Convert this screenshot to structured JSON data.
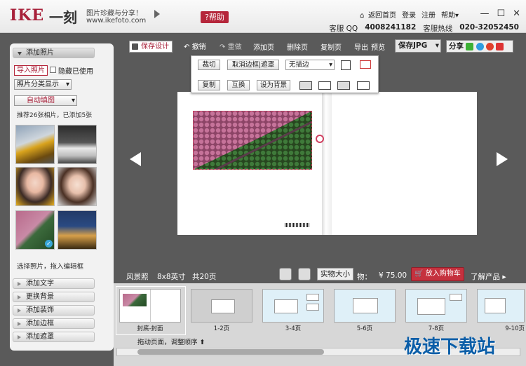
{
  "titlebar": {
    "logo": "IKE",
    "logo_cn": "一刻",
    "slogan": "图片珍藏与分享！",
    "site": "www.ikefoto.com",
    "help": "?帮助",
    "nav": [
      "返回首页",
      "登录",
      "注册",
      "帮助"
    ],
    "window_controls": [
      "—",
      "☐",
      "✕"
    ],
    "qq_label": "客服 QQ",
    "qq_value": "4008241182",
    "hotline_label": "客服热线",
    "hotline_value": "020-32052450"
  },
  "toolbar": {
    "save_design": "保存设计",
    "undo": "撤销",
    "redo": "重做",
    "add_page": "添加页",
    "delete_page": "删除页",
    "copy_page": "复制页",
    "export": "导出",
    "preview": "预览",
    "save_jpg": "保存JPG",
    "share": "分享"
  },
  "popup": {
    "crop": "裁切",
    "cancel_mask": "取消边框|遮罩",
    "border_select": "无描边",
    "copy": "复制",
    "swap": "互换",
    "set_bg": "设为背景"
  },
  "left": {
    "add_photo": "添加照片",
    "import": "导入照片",
    "hide_used": "隐藏已使用",
    "category": "照片分类显示",
    "auto_fill": "自动填图",
    "hint_count": "推荐26张相片，已添加5张",
    "drag_hint": "选择照片，拖入编辑框",
    "sections": [
      "添加文字",
      "更换背景",
      "添加装饰",
      "添加边框",
      "添加遮罩"
    ]
  },
  "info": {
    "style": "风景照",
    "size": "8x8英寸",
    "pages": "共20页",
    "real_size": "实物大小",
    "price_label": "物：",
    "price": "¥ 75.00",
    "cart": "放入购物车",
    "learn": "了解产品"
  },
  "pages": [
    {
      "label": "封底-封面"
    },
    {
      "label": "1-2页"
    },
    {
      "label": "3-4页"
    },
    {
      "label": "5-6页"
    },
    {
      "label": "7-8页"
    },
    {
      "label": "9-10页"
    }
  ],
  "drag_order": "拖动页面，调整顺序",
  "watermark": "极速下载站",
  "colors": {
    "brand": "#a8213a",
    "cart": "#c5313e",
    "workspace": "#5a5a5a"
  }
}
